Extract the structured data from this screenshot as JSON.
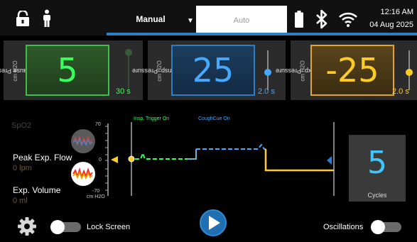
{
  "topbar": {
    "tabs": [
      {
        "label": "Manual",
        "selected": false
      },
      {
        "label": "Auto",
        "selected": true
      }
    ],
    "time": "12:16 AM",
    "date": "04 Aug 2025",
    "accent": "#2d7fc0"
  },
  "panels": [
    {
      "title": "Pause Pressure",
      "unit": "cm H2O",
      "value": "5",
      "time": "30 s",
      "time_color": "#39ff5e",
      "color": "#3cbf4b"
    },
    {
      "title": "Insp. Pressure",
      "unit": "cm H2O",
      "value": "25",
      "time": "2.0 s",
      "time_color": "#46a9ff",
      "color": "#2c7fc7"
    },
    {
      "title": "Exp. Pressure",
      "unit": "cm H2O",
      "value": "-25",
      "time": "2.0 s",
      "time_color": "#ffcc24",
      "color": "#e0a52a"
    }
  ],
  "monitor": {
    "sp02_label": "SpO2",
    "peak_flow_label": "Peak Exp. Flow",
    "peak_flow_value": "0 lpm",
    "volume_label": "Exp. Volume",
    "volume_value": "0 ml"
  },
  "graph": {
    "y_max_label": "70",
    "y_zero_label": "0",
    "y_min_label": "-70",
    "y_unit": "cm H2O",
    "insp_trigger_label": "Insp. Trigger On",
    "coughcue_label": "CoughCue On",
    "insp_trigger_color": "#39ff5e",
    "coughcue_color": "#46a9ff"
  },
  "cycles": {
    "value": "5",
    "label": "Cycles"
  },
  "bottom": {
    "lock_screen_label": "Lock Screen",
    "lock_screen_on": false,
    "oscillations_label": "Oscillations",
    "oscillations_on": false
  },
  "icons": [
    "lock-icon",
    "person-icon",
    "battery-icon",
    "bluetooth-icon",
    "wifi-icon",
    "gear-icon",
    "play-icon",
    "waveform-icon"
  ]
}
